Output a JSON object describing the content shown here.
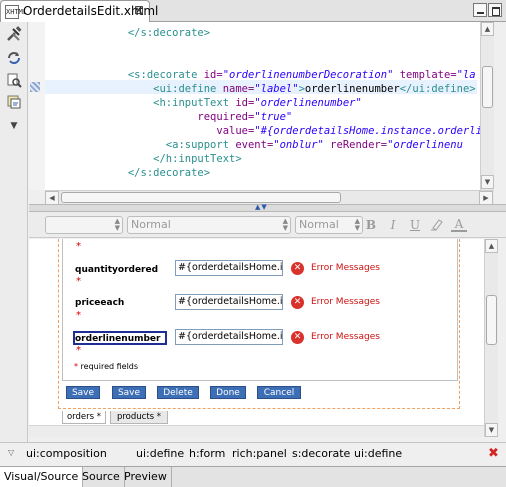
{
  "editor_tab": {
    "file_icon_text": "XHTML",
    "title": "OrderdetailsEdit.xhtml",
    "close_glyph": "⊠"
  },
  "left_toolbar": [
    "wrench-hammer-icon",
    "refresh-icon",
    "find-replace-icon",
    "external-tag-icon",
    "dropdown-arrow-icon"
  ],
  "source_code": {
    "line1": {
      "indent": "            ",
      "close_tag": "</s:decorate>"
    },
    "line2": {
      "indent": "            ",
      "open": "<s:decorate",
      "a1": " id=",
      "v1": "\"orderlinenumberDecoration\"",
      "a2": " template=",
      "v2": "\"la"
    },
    "line3": {
      "indent": "                ",
      "open": "<ui:define",
      "a1": " name=",
      "v1": "\"label\"",
      "gt": ">",
      "text": "orderlinenumber",
      "close": "</ui:define>"
    },
    "line4": {
      "indent": "                ",
      "open": "<h:inputText",
      "a1": " id=",
      "v1": "\"orderlinenumber\""
    },
    "line5": {
      "indent": "                       ",
      "a1": "required=",
      "v1": "\"true\""
    },
    "line6": {
      "indent": "                          ",
      "a1": "value=",
      "v1": "\"#{orderdetailsHome.instance.orderli"
    },
    "line7": {
      "indent": "                  ",
      "open": "<a:support",
      "a1": " event=",
      "v1": "\"onblur\"",
      "a2": " reRender=",
      "v2": "\"orderlinenu"
    },
    "line8": {
      "indent": "                ",
      "close_tag": "</h:inputText>"
    },
    "line9": {
      "indent": "            ",
      "close_tag": "</s:decorate>"
    }
  },
  "format_toolbar": {
    "font_combo": "",
    "style_combo": "Normal",
    "size_combo": "Normal",
    "bold": "B",
    "italic": "I",
    "underline": "U",
    "highlight": "A",
    "font_color": "A"
  },
  "form": {
    "required_mark": "*",
    "fields": [
      {
        "label": "quantityordered",
        "value": "#{orderdetailsHome.instan",
        "error": "Error Messages"
      },
      {
        "label": "priceeach",
        "value": "#{orderdetailsHome.instan",
        "error": "Error Messages"
      },
      {
        "label": "orderlinenumber",
        "value": "#{orderdetailsHome.instan",
        "error": "Error Messages"
      }
    ],
    "required_note": "* required fields",
    "buttons": [
      "Save",
      "Save",
      "Delete",
      "Done",
      "Cancel"
    ]
  },
  "panel_tabs": [
    "orders *",
    "products *"
  ],
  "tag_breadcrumb": [
    "ui:composition",
    "ui:define",
    "h:form",
    "rich:panel",
    "s:decorate",
    "ui:define"
  ],
  "bottom_tabs": [
    "Visual/Source",
    "Source",
    "Preview"
  ],
  "colors": {
    "tag": "#2a8f8f",
    "attribute": "#7f007f",
    "value": "#2a00ff",
    "error": "#d01010",
    "button": "#3d6fb6"
  }
}
